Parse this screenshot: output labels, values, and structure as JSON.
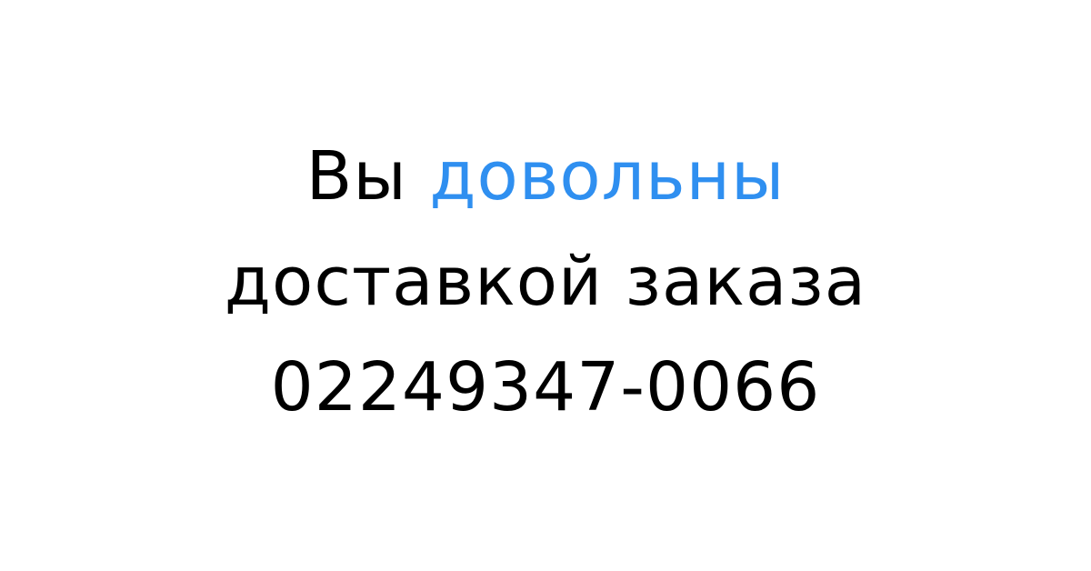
{
  "message": {
    "line1_prefix": "Вы",
    "line1_highlight": "довольны",
    "line2": "доставкой заказа",
    "phone": "02249347-0066"
  },
  "colors": {
    "text": "#000000",
    "accent": "#2f8ff0",
    "background": "#ffffff"
  }
}
